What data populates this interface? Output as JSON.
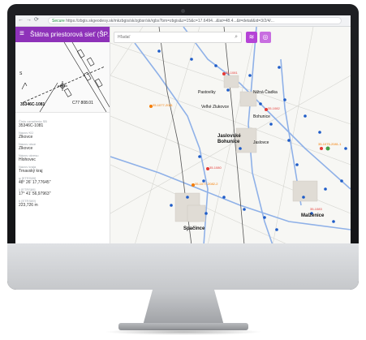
{
  "browser": {
    "url_secure": "Secure",
    "url": "https://zbgis.skgeodesy.sk/mkzbgis/sk/zgbsr/sk/rgbs?bm=zbgis&z=15&c=17.6494...&lat=48.4...&t=detail&id=3/2/4/..."
  },
  "app": {
    "title": "Štátna priestorová sieť (ŠP...",
    "menu_icon": "hamburger-menu-icon",
    "collapse_icon": "chevron-left-icon"
  },
  "sketch": {
    "point_id": "35346C-1081",
    "point_label_right": "C77 808.01",
    "north_marker": "S"
  },
  "details": [
    {
      "label": "Číslo označenia SB",
      "value": "35346C-1081"
    },
    {
      "label": "Názov KÚ",
      "value": "Zlkovce"
    },
    {
      "label": "Názov obce",
      "value": "Zlkovce"
    },
    {
      "label": "Názov okresu",
      "value": "Hlohovec"
    },
    {
      "label": "Názov kraja",
      "value": "Trnavský kraj"
    },
    {
      "label": "φ [ETRS89]",
      "value": "48° 26' 17,77645\""
    },
    {
      "label": "λ [ETRS89]",
      "value": "17° 41' 56,97963\""
    },
    {
      "label": "h [ETRS89]",
      "value": "223,726 m"
    }
  ],
  "search": {
    "placeholder": "Hľadať",
    "icon": "search-icon"
  },
  "toolbar": {
    "layers_icon": "layers-icon",
    "location_icon": "location-icon"
  },
  "map": {
    "places": [
      {
        "name": "Pastovíky",
        "big": false
      },
      {
        "name": "Veľké Zlukovce",
        "big": false
      },
      {
        "name": "Nižná Čiadka",
        "big": false
      },
      {
        "name": "Bohunice",
        "big": false
      },
      {
        "name": "Jaslovské Bohunice",
        "big": true
      },
      {
        "name": "Malženice",
        "big": true
      },
      {
        "name": "Jaslovce",
        "big": false
      },
      {
        "name": "Spačince",
        "big": true
      },
      {
        "name": "Malženice",
        "big": true
      }
    ],
    "labels": [
      {
        "text": "35-1081",
        "kind": "red"
      },
      {
        "text": "35-1077-2081",
        "kind": "orange"
      },
      {
        "text": "35-1082",
        "kind": "red"
      },
      {
        "text": "35-1080",
        "kind": "red"
      },
      {
        "text": "35-1077-2082-2",
        "kind": "orange"
      },
      {
        "text": "35-1075-2081-1",
        "kind": "orange"
      },
      {
        "text": "35-1083",
        "kind": "red"
      }
    ],
    "colors": {
      "point_blue": "#1e5cc8",
      "point_red": "#e53935",
      "point_orange": "#f57c00",
      "point_green": "#43a047",
      "road": "#8fb1e8"
    }
  }
}
